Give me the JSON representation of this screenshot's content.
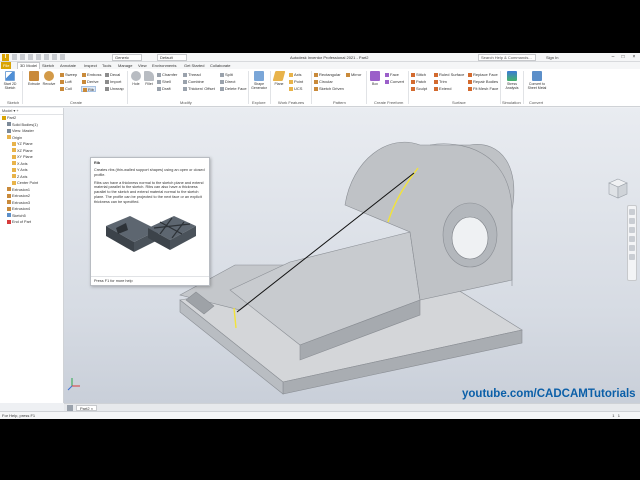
{
  "app": {
    "logo": "I",
    "title": "Autodesk Inventor Professional 2021 - Part2",
    "appearance": "Generic",
    "material": "Default",
    "search_placeholder": "Search Help & Commands...",
    "signin": "Sign In"
  },
  "tabs": [
    "File",
    "3D Model",
    "Sketch",
    "Annotate",
    "Inspect",
    "Tools",
    "Manage",
    "View",
    "Environments",
    "Get Started",
    "Collaborate"
  ],
  "ribbon": {
    "panels": [
      "Sketch",
      "Create",
      "Modify",
      "Explore",
      "Work Features",
      "Pattern",
      "Create Freeform",
      "Surface",
      "Simulation",
      "Convert"
    ],
    "sketch": {
      "start": "Start 2D Sketch"
    },
    "create": {
      "extrude": "Extrude",
      "revolve": "Revolve",
      "sweep": "Sweep",
      "loft": "Loft",
      "coil": "Coil",
      "emboss": "Emboss",
      "derive": "Derive",
      "rib": "Rib",
      "decal": "Decal",
      "import": "Import",
      "unwrap": "Unwrap"
    },
    "modify": {
      "hole": "Hole",
      "fillet": "Fillet",
      "chamfer": "Chamfer",
      "shell": "Shell",
      "draft": "Draft",
      "thread": "Thread",
      "combine": "Combine",
      "thicken": "Thicken/ Offset",
      "split": "Split",
      "direct": "Direct",
      "delete_face": "Delete Face"
    },
    "explore": {
      "shape_generator": "Shape Generator"
    },
    "work": {
      "plane": "Plane",
      "axis": "Axis",
      "point": "Point",
      "ucs": "UCS"
    },
    "pattern": {
      "rectangular": "Rectangular",
      "circular": "Circular",
      "sketch_driven": "Sketch Driven",
      "mirror": "Mirror"
    },
    "freeform": {
      "box": "Box",
      "face": "Face",
      "convert": "Convert"
    },
    "surface": {
      "stitch": "Stitch",
      "patch": "Patch",
      "sculpt": "Sculpt",
      "ruled": "Ruled Surface",
      "trim": "Trim",
      "extend": "Extend",
      "replace": "Replace Face",
      "repair": "Repair Bodies",
      "fit_mesh": "Fit Mesh Face"
    },
    "simulation": {
      "stress": "Stress Analysis"
    },
    "convert": {
      "sheet_metal": "Convert to Sheet Metal"
    }
  },
  "browser": {
    "header": "Model",
    "items": [
      {
        "label": "Part2",
        "indent": 0
      },
      {
        "label": "Solid Bodies(1)",
        "indent": 1
      },
      {
        "label": "View: Master",
        "indent": 1
      },
      {
        "label": "Origin",
        "indent": 1
      },
      {
        "label": "YZ Plane",
        "indent": 2
      },
      {
        "label": "XZ Plane",
        "indent": 2
      },
      {
        "label": "XY Plane",
        "indent": 2
      },
      {
        "label": "X Axis",
        "indent": 2
      },
      {
        "label": "Y Axis",
        "indent": 2
      },
      {
        "label": "Z Axis",
        "indent": 2
      },
      {
        "label": "Center Point",
        "indent": 2
      },
      {
        "label": "Extrusion1",
        "indent": 1
      },
      {
        "label": "Extrusion2",
        "indent": 1
      },
      {
        "label": "Extrusion3",
        "indent": 1
      },
      {
        "label": "Extrusion4",
        "indent": 1
      },
      {
        "label": "Sketch5",
        "indent": 1
      },
      {
        "label": "End of Part",
        "indent": 1
      }
    ]
  },
  "tooltip": {
    "title": "Rib",
    "desc1": "Creates ribs (thin-walled support shapes) using an open or closed profile.",
    "desc2": "Ribs can have a thickness normal to the sketch plane and extend material parallel to the sketch. Ribs can also have a thickness parallel to the sketch and extend material normal to the sketch plane. The profile can be projected to the next face or an explicit thickness can be specified.",
    "footer": "Press F1 for more help"
  },
  "doc_tab": "Part2",
  "status": {
    "left": "For Help, press F1",
    "right_a": "1",
    "right_b": "1"
  },
  "watermark": "youtube.com/CADCAMTutorials",
  "colors": {
    "accent": "#d9a404",
    "viewport": "#dde1e8",
    "part": "#c9cccf",
    "sketch_line": "#111111",
    "highlight_edge": "#f2e33a"
  }
}
